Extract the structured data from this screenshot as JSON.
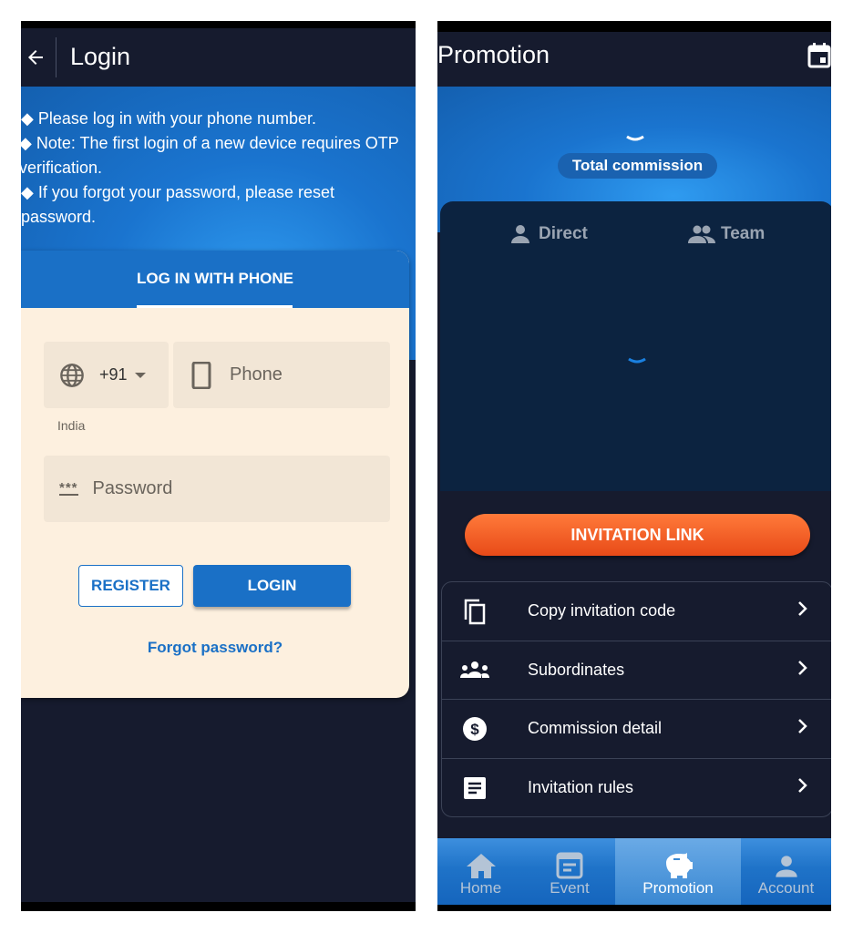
{
  "login": {
    "title": "Login",
    "notes": [
      "◆ Please log in with your phone number.",
      "◆ Note: The first login of a new device requires OTP verification.",
      "◆ If you forgot your password, please reset password."
    ],
    "tab": "LOG IN WITH PHONE",
    "country_code": "+91",
    "country_name": "India",
    "phone_placeholder": "Phone",
    "password_placeholder": "Password",
    "register": "REGISTER",
    "login": "LOGIN",
    "forgot": "Forgot password?"
  },
  "promotion": {
    "title": "Promotion",
    "total_commission": "Total commission",
    "tabs": [
      "Direct",
      "Team"
    ],
    "invitation_link": "INVITATION LINK",
    "menu": [
      {
        "label": "Copy invitation code",
        "icon": "copy-icon"
      },
      {
        "label": "Subordinates",
        "icon": "group-icon"
      },
      {
        "label": "Commission detail",
        "icon": "dollar-icon"
      },
      {
        "label": "Invitation rules",
        "icon": "document-icon"
      }
    ],
    "nav": [
      {
        "label": "Home",
        "icon": "home-icon",
        "active": false
      },
      {
        "label": "Event",
        "icon": "calendar-icon",
        "active": false
      },
      {
        "label": "Promotion",
        "icon": "piggy-bank-icon",
        "active": true
      },
      {
        "label": "Account",
        "icon": "person-icon",
        "active": false
      }
    ]
  },
  "colors": {
    "accent": "#1a70c6",
    "orange": "#f05a22",
    "background": "#161b2e",
    "card": "#fdf0df"
  }
}
